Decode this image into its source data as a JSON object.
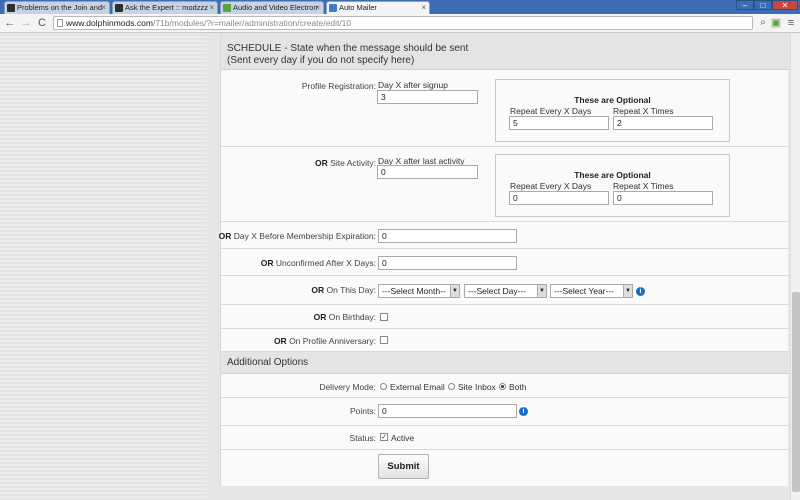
{
  "browser": {
    "tabs": [
      {
        "label": "Problems on the Join and"
      },
      {
        "label": "Ask the Expert :: modzzz"
      },
      {
        "label": "Audio and Video Electron"
      },
      {
        "label": "Auto Mailer"
      }
    ],
    "url_host": "www.dolphinmods.com",
    "url_path": "/71b/modules/?r=mailer/administration/create/edit/10",
    "nav": {
      "back": "←",
      "forward": "→",
      "reload": "C"
    },
    "window_buttons": {
      "minimize": "–",
      "maximize": "□",
      "close": "✕"
    }
  },
  "schedule": {
    "heading_line1": "SCHEDULE - State when the message should be sent",
    "heading_line2": "(Sent every day if you do not specify here)",
    "profile_registration": {
      "label": "Profile Registration:",
      "sub_label": "Day X after signup",
      "value": "3",
      "optional_title": "These are Optional",
      "repeat_days_label": "Repeat Every X Days",
      "repeat_days_value": "5",
      "repeat_times_label": "Repeat X Times",
      "repeat_times_value": "2"
    },
    "site_activity": {
      "or": "OR",
      "label": "Site Activity:",
      "sub_label": "Day X after last activity",
      "value": "0",
      "optional_title": "These are Optional",
      "repeat_days_label": "Repeat Every X Days",
      "repeat_days_value": "0",
      "repeat_times_label": "Repeat X Times",
      "repeat_times_value": "0"
    },
    "membership_expiration": {
      "or": "OR",
      "label": "Day X Before Membership Expiration:",
      "value": "0"
    },
    "unconfirmed": {
      "or": "OR",
      "label": "Unconfirmed After X Days:",
      "value": "0"
    },
    "on_this_day": {
      "or": "OR",
      "label": "On This Day:",
      "month": "---Select Month--",
      "day": "---Select Day---",
      "year": "---Select Year---"
    },
    "birthday": {
      "or": "OR",
      "label": "On Birthday:"
    },
    "anniversary": {
      "or": "OR",
      "label": "On Profile Anniversary:"
    }
  },
  "additional": {
    "heading": "Additional Options",
    "delivery": {
      "label": "Delivery Mode:",
      "options": [
        "External Email",
        "Site Inbox",
        "Both"
      ],
      "selected": "Both"
    },
    "points": {
      "label": "Points:",
      "value": "0"
    },
    "status": {
      "label": "Status:",
      "check_label": "Active",
      "checked": true
    },
    "submit_label": "Submit"
  },
  "colors": {
    "accent": "#1a6bc6",
    "tabbar": "#3c6db4"
  }
}
